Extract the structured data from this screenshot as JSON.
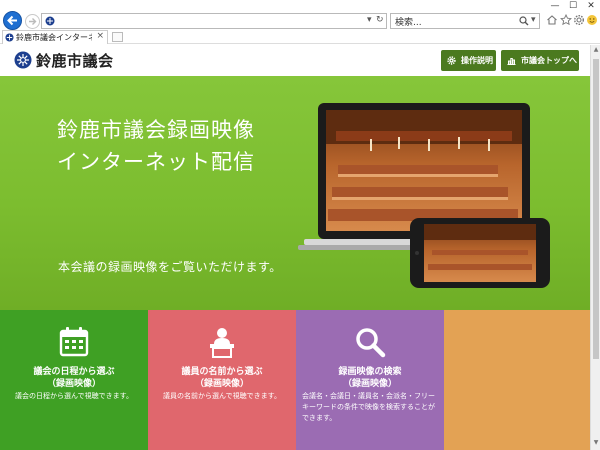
{
  "browser": {
    "window_controls": {
      "minimize": "—",
      "maximize": "☐",
      "close": "✕"
    },
    "search_placeholder": "検索...",
    "tab": {
      "title": "鈴鹿市議会インターネット議会...",
      "close": "×"
    }
  },
  "header": {
    "site_name": "鈴鹿市議会",
    "manual_button": "操作説明",
    "top_button": "市議会トップへ"
  },
  "hero": {
    "title_line1": "鈴鹿市議会録画映像",
    "title_line2": "インターネット配信",
    "subtitle": "本会議の録画映像をご覧いただけます。"
  },
  "cards": [
    {
      "title_line1": "議会の日程から選ぶ",
      "title_line2": "（録画映像）",
      "desc": "議会の日程から選んで視聴できます。",
      "icon": "calendar-icon"
    },
    {
      "title_line1": "議員の名前から選ぶ",
      "title_line2": "（録画映像）",
      "desc": "議員の名前から選んで視聴できます。",
      "icon": "speaker-podium-icon"
    },
    {
      "title_line1": "録画映像の検索",
      "title_line2": "（録画映像）",
      "desc": "会議名・会議日・議員名・会派名・フリーキーワードの条件で映像を検索することができます。",
      "icon": "magnifier-icon"
    },
    {
      "title_line1": "",
      "title_line2": "",
      "desc": "",
      "icon": ""
    }
  ],
  "colors": {
    "header_button": "#4b7a1f",
    "hero_green": "#7cbd2f",
    "card_green": "#3fa024",
    "card_pink": "#e0676d",
    "card_purple": "#9b6cb3",
    "card_orange": "#e3a254"
  }
}
